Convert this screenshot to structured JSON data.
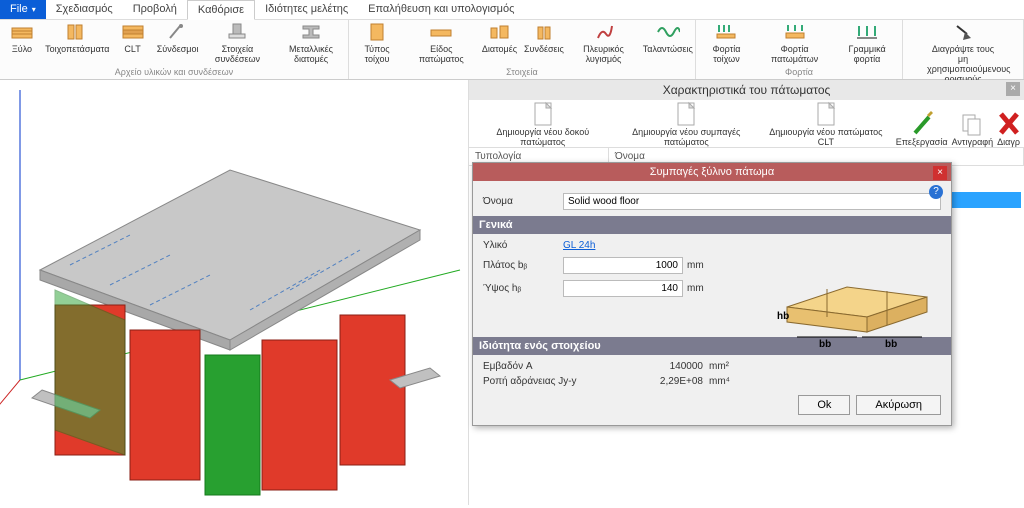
{
  "menu": {
    "file": "File",
    "file_arrow": "▾"
  },
  "tabs": [
    "Σχεδιασμός",
    "Προβολή",
    "Καθόρισε",
    "Ιδιότητες μελέτης",
    "Επαλήθευση και υπολογισμός"
  ],
  "active_tab_index": 2,
  "ribbon": {
    "groups": [
      {
        "label": "Αρχείο υλικών και συνδέσεων",
        "buttons": [
          "Ξύλο",
          "Τοιχοπετάσματα",
          "CLT",
          "Σύνδεσμοι",
          "Στοιχεία συνδέσεων",
          "Μεταλλικές διατομές"
        ]
      },
      {
        "label": "Στοιχεία",
        "buttons": [
          "Τύπος τοίχου",
          "Είδος πατώματος",
          "Διατομές",
          "Συνδέσεις",
          "Πλευρικός λυγισμός",
          "Ταλαντώσεις"
        ]
      },
      {
        "label": "Φορτία",
        "buttons": [
          "Φορτία τοίχων",
          "Φορτία πατωμάτων",
          "Γραμμικά φορτία"
        ]
      },
      {
        "label": "",
        "buttons": [
          "Διαγράψτε τους μη χρησιμοποιούμενους ορισμούς"
        ]
      }
    ]
  },
  "panel": {
    "title": "Χαρακτηριστικά του πάτωματος",
    "toolbar": [
      "Δημιουργία νέου δοκού πατώματος",
      "Δημιουργία νέου συμπαγές πατώματος",
      "Δημιουργία νέου πατώματος CLT",
      "Επεξεργασία",
      "Αντιγραφή",
      "Διαγρ"
    ],
    "columns": [
      "Τυπολογία",
      "Όνομα"
    ]
  },
  "dialog": {
    "title": "Συμπαγές ξύλινο πάτωμα",
    "name_label": "Όνομα",
    "name_value": "Solid wood floor",
    "section_general": "Γενικά",
    "material_label": "Υλικό",
    "material_value": "GL 24h",
    "width_label": "Πλάτος bᵦ",
    "width_value": "1000",
    "width_unit": "mm",
    "height_label": "Ύψος hᵦ",
    "height_value": "140",
    "height_unit": "mm",
    "diagram_h": "hb",
    "diagram_b1": "bb",
    "diagram_b2": "bb",
    "section_props": "Ιδιότητα ενός στοιχείου",
    "area_label": "Εμβαδόν A",
    "area_value": "140000",
    "area_unit": "mm²",
    "inertia_label": "Ροπή αδράνειας Jy-y",
    "inertia_value": "2,29E+08",
    "inertia_unit": "mm⁴",
    "ok": "Ok",
    "cancel": "Ακύρωση"
  }
}
